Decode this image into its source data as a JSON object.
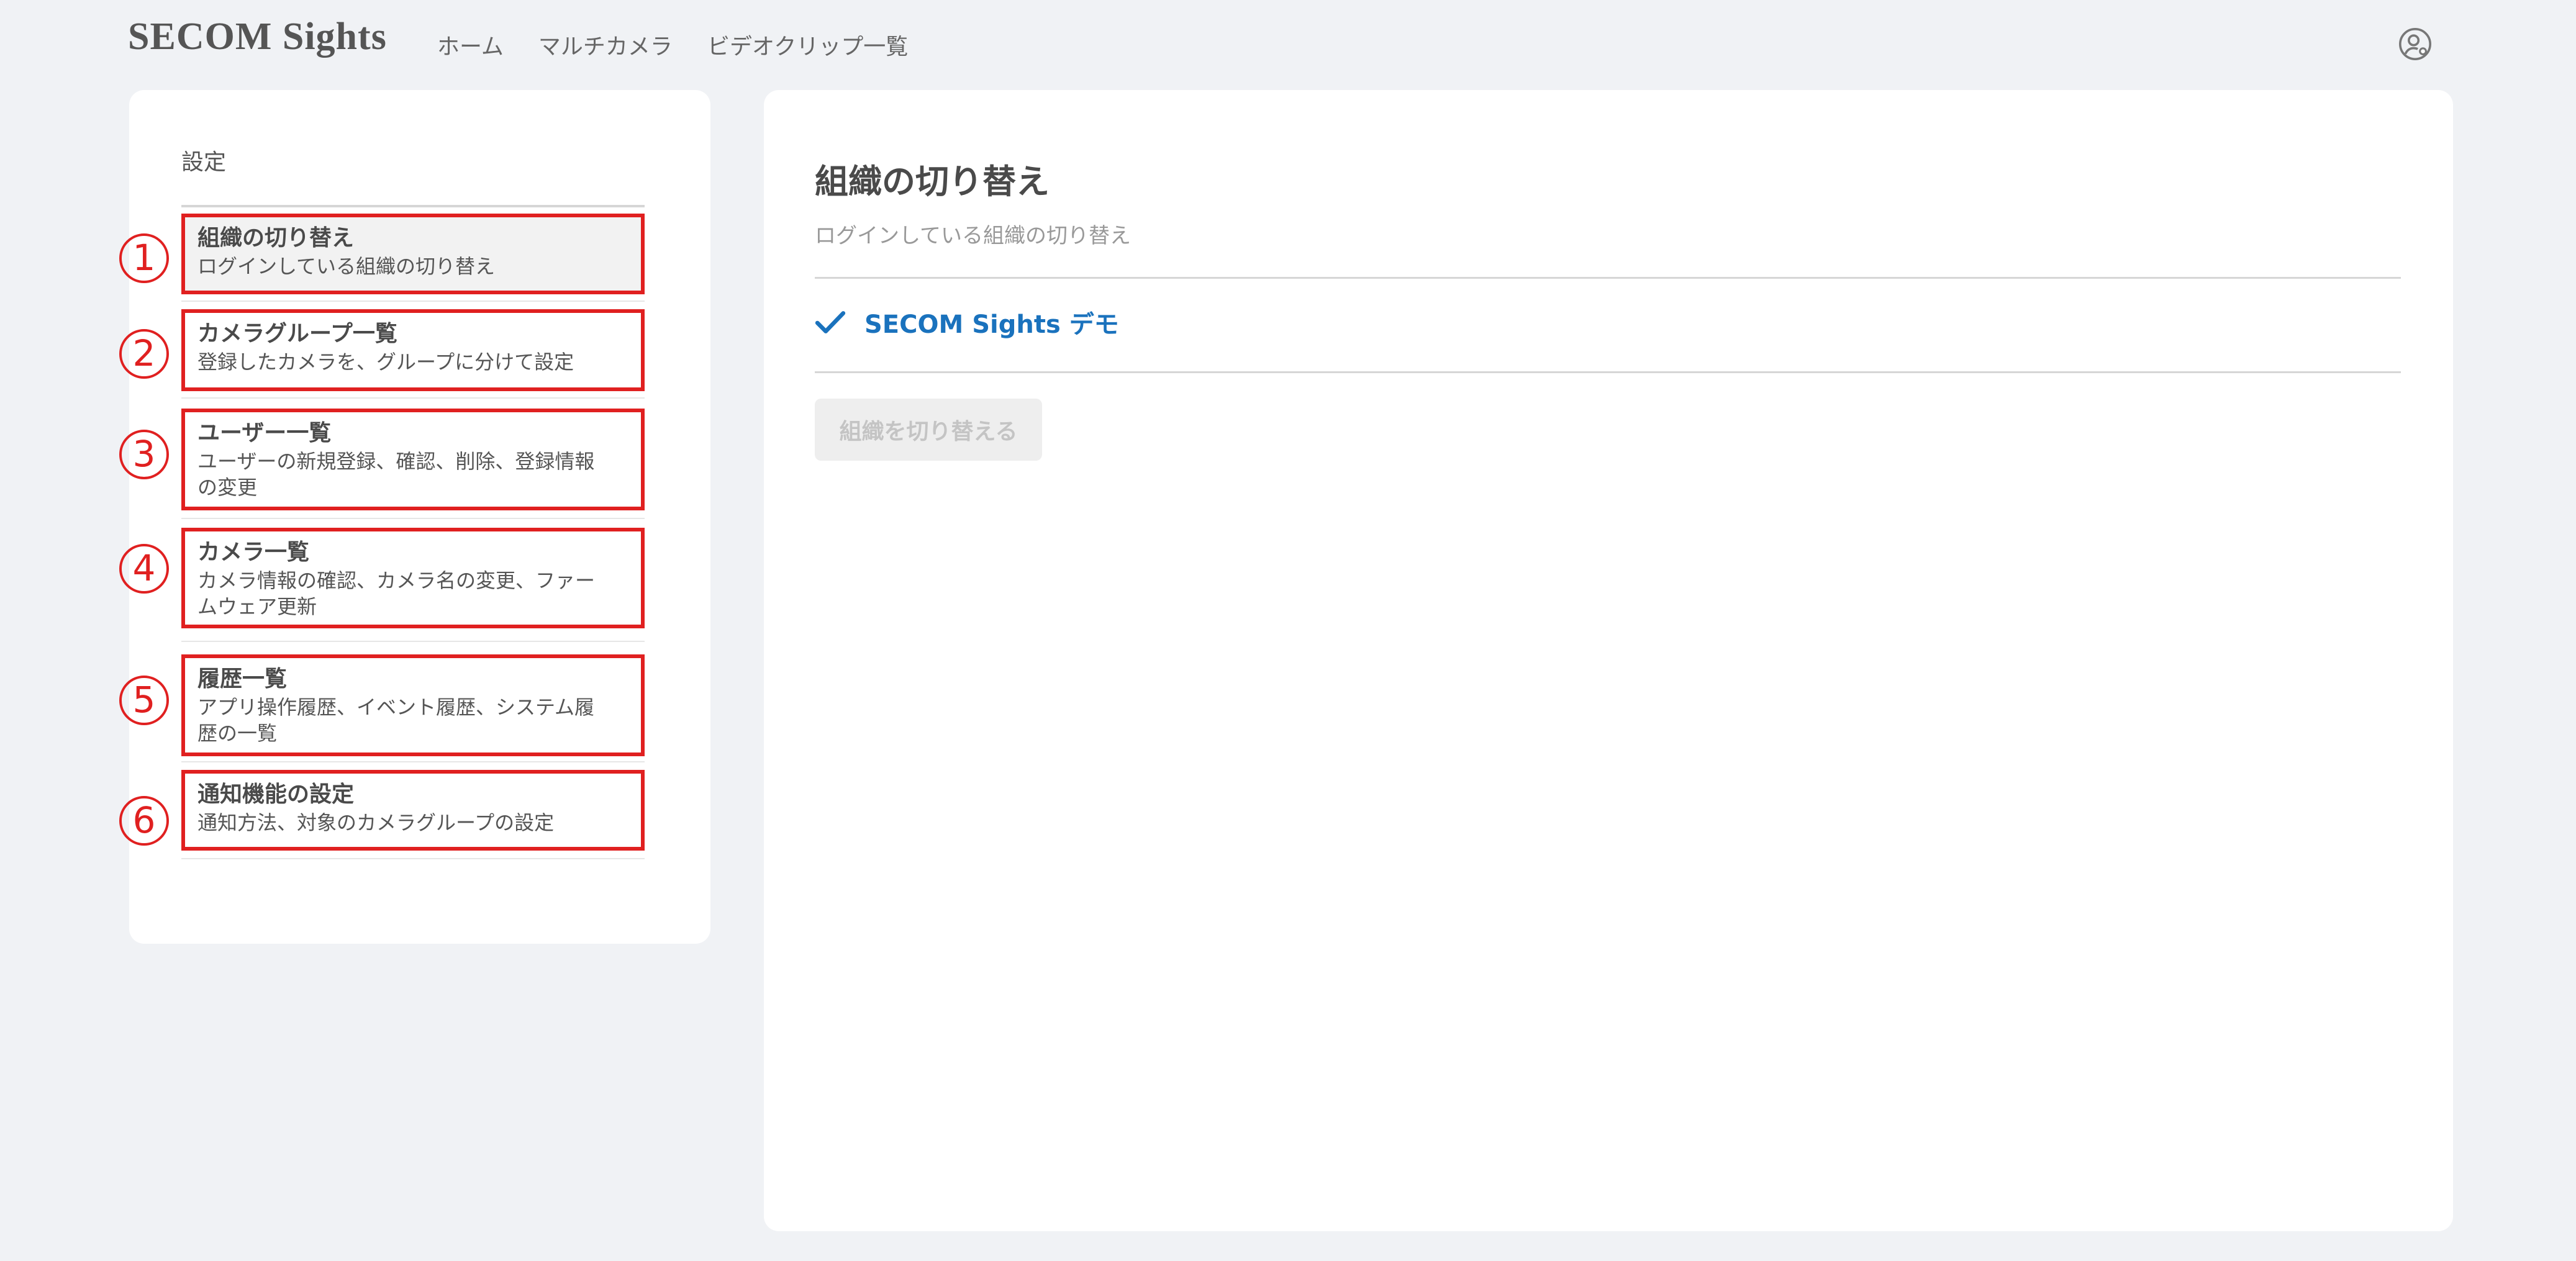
{
  "header": {
    "logo": "SECOM Sights",
    "nav": [
      "ホーム",
      "マルチカメラ",
      "ビデオクリップ一覧"
    ]
  },
  "sidebar": {
    "title": "設定",
    "items": [
      {
        "number": "1",
        "title": "組織の切り替え",
        "desc": "ログインしている組織の切り替え"
      },
      {
        "number": "2",
        "title": "カメラグループ一覧",
        "desc": "登録したカメラを、グループに分けて設定"
      },
      {
        "number": "3",
        "title": "ユーザー一覧",
        "desc": "ユーザーの新規登録、確認、削除、登録情報の変更"
      },
      {
        "number": "4",
        "title": "カメラ一覧",
        "desc": "カメラ情報の確認、カメラ名の変更、ファームウェア更新"
      },
      {
        "number": "5",
        "title": "履歴一覧",
        "desc": "アプリ操作履歴、イベント履歴、システム履歴の一覧"
      },
      {
        "number": "6",
        "title": "通知機能の設定",
        "desc": "通知方法、対象のカメラグループの設定"
      }
    ]
  },
  "main": {
    "title": "組織の切り替え",
    "subtitle": "ログインしている組織の切り替え",
    "organization": "SECOM Sights デモ",
    "switch_button": "組織を切り替える"
  },
  "icons": {
    "user": "user-gear-icon",
    "check": "check-icon"
  },
  "colors": {
    "accent": "#1a72bd",
    "annotation": "#e02020",
    "background": "#f0f2f5"
  }
}
